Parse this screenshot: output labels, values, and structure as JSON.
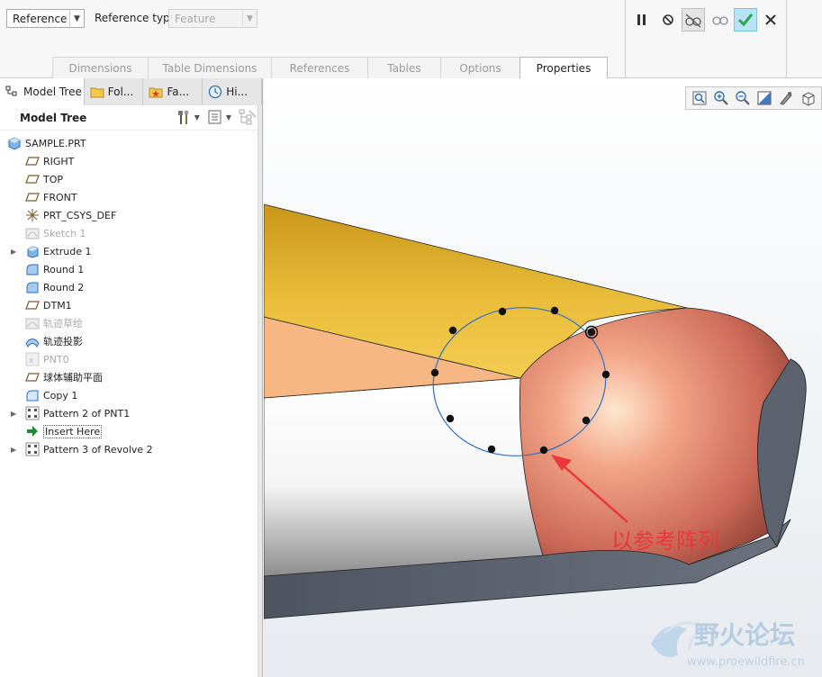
{
  "dashboard": {
    "pattern_type": "Reference",
    "reference_type_label": "Reference type",
    "reference_type_value": "Feature",
    "tabs": [
      "Dimensions",
      "Table Dimensions",
      "References",
      "Tables",
      "Options",
      "Properties"
    ],
    "active_tab": "Properties"
  },
  "navigator": {
    "tabs": [
      "Model Tree",
      "Fol...",
      "Fa...",
      "Hi..."
    ],
    "header": "Model Tree",
    "items": [
      {
        "label": "SAMPLE.PRT",
        "icon": "part-icon",
        "level": 0,
        "expand": false,
        "dim": false
      },
      {
        "label": "RIGHT",
        "icon": "datum-plane-icon",
        "level": 1,
        "expand": false,
        "dim": false
      },
      {
        "label": "TOP",
        "icon": "datum-plane-icon",
        "level": 1,
        "expand": false,
        "dim": false
      },
      {
        "label": "FRONT",
        "icon": "datum-plane-icon",
        "level": 1,
        "expand": false,
        "dim": false
      },
      {
        "label": "PRT_CSYS_DEF",
        "icon": "csys-icon",
        "level": 1,
        "expand": false,
        "dim": false
      },
      {
        "label": "Sketch 1",
        "icon": "sketch-icon",
        "level": 1,
        "expand": false,
        "dim": true
      },
      {
        "label": "Extrude 1",
        "icon": "extrude-icon",
        "level": 1,
        "expand": true,
        "dim": false
      },
      {
        "label": "Round 1",
        "icon": "round-icon",
        "level": 1,
        "expand": false,
        "dim": false
      },
      {
        "label": "Round 2",
        "icon": "round-icon",
        "level": 1,
        "expand": false,
        "dim": false
      },
      {
        "label": "DTM1",
        "icon": "datum-plane-icon",
        "level": 1,
        "expand": false,
        "dim": false
      },
      {
        "label": "轨迹草绘",
        "icon": "sketch-icon",
        "level": 1,
        "expand": false,
        "dim": true
      },
      {
        "label": "轨迹投影",
        "icon": "projection-icon",
        "level": 1,
        "expand": false,
        "dim": false
      },
      {
        "label": "PNT0",
        "icon": "datum-point-icon",
        "level": 1,
        "expand": false,
        "dim": true
      },
      {
        "label": "球体辅助平面",
        "icon": "datum-plane-icon",
        "level": 1,
        "expand": false,
        "dim": false
      },
      {
        "label": "Copy 1",
        "icon": "copy-icon",
        "level": 1,
        "expand": false,
        "dim": false
      },
      {
        "label": "Pattern 2 of PNT1",
        "icon": "pattern-icon",
        "level": 1,
        "expand": true,
        "dim": false
      },
      {
        "label": "Insert Here",
        "icon": "insert-arrow-icon",
        "level": 1,
        "expand": false,
        "dim": false
      },
      {
        "label": "Pattern 3 of Revolve 2",
        "icon": "pattern-icon",
        "level": 1,
        "expand": true,
        "dim": false
      }
    ]
  },
  "viewport": {
    "annotation": "以参考阵列",
    "watermark_cn": "野火论坛",
    "watermark_url": "www.proewildfire.cn"
  },
  "colors": {
    "yellow_face": "#d4a21e",
    "orange_face": "#f6b783",
    "red_face": "#c86c5c",
    "slate_face": "#5b636f",
    "accent_green": "#2da44e",
    "annotation_red": "#e8383b"
  }
}
